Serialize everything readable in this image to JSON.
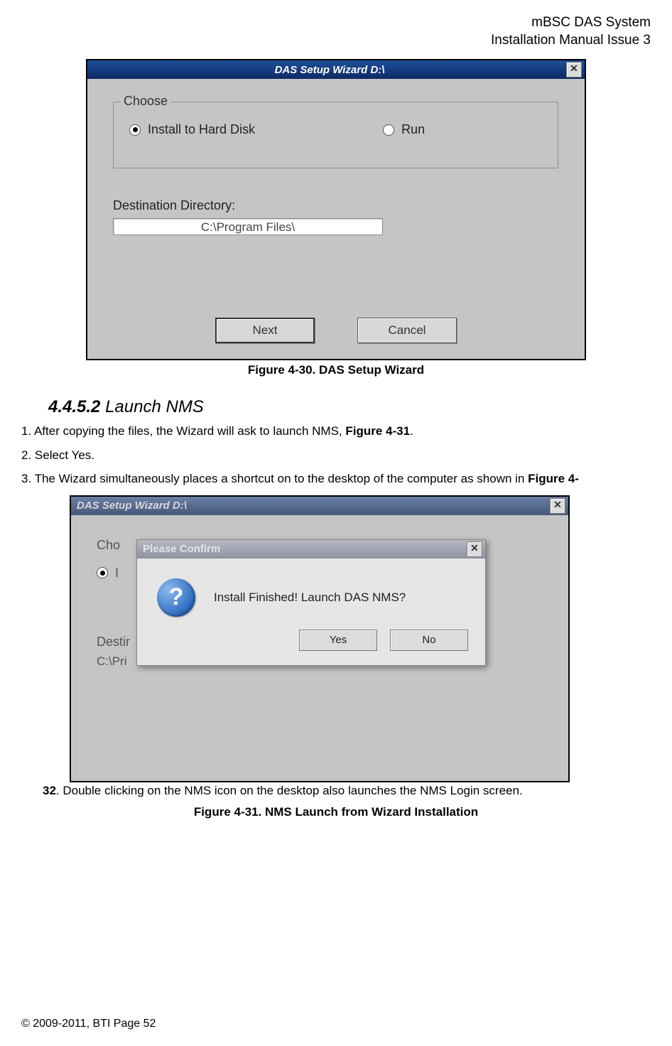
{
  "header": {
    "line1": "mBSC DAS System",
    "line2": "Installation Manual Issue 3"
  },
  "figure30": {
    "title": "DAS Setup Wizard D:\\",
    "group_label": "Choose",
    "radio1": "Install to Hard Disk",
    "radio2": "Run",
    "dest_label": "Destination Directory:",
    "dest_value": "C:\\Program Files\\",
    "next_btn": "Next",
    "cancel_btn": "Cancel",
    "caption": "Figure 4-30. DAS Setup Wizard"
  },
  "section": {
    "num": "4.4.5.2",
    "title": " Launch NMS"
  },
  "steps": {
    "s1": "1.  After copying the files, the Wizard will ask to launch NMS, ",
    "s1_bold": "Figure 4-31",
    "s1_end": ".",
    "s2": "2.  Select Yes.",
    "s3": "3.  The Wizard simultaneously places a shortcut on to the desktop of the computer as shown in ",
    "s3_bold": "Figure 4-"
  },
  "figure31": {
    "title": "DAS Setup Wizard D:\\",
    "stub_choose": "Cho",
    "stub_radio": "I",
    "stub_dest": "Destir",
    "stub_input": "C:\\Pri",
    "confirm_title": "Please Confirm",
    "confirm_text": "Install Finished! Launch DAS NMS?",
    "yes_btn": "Yes",
    "no_btn": "No",
    "after_bold": "32",
    "after_text": ". Double clicking on the NMS icon on the desktop also launches the NMS Login screen.",
    "caption": "Figure 4-31. NMS Launch from Wizard Installation"
  },
  "footer": "© 2009-2011, BTI Page 52"
}
